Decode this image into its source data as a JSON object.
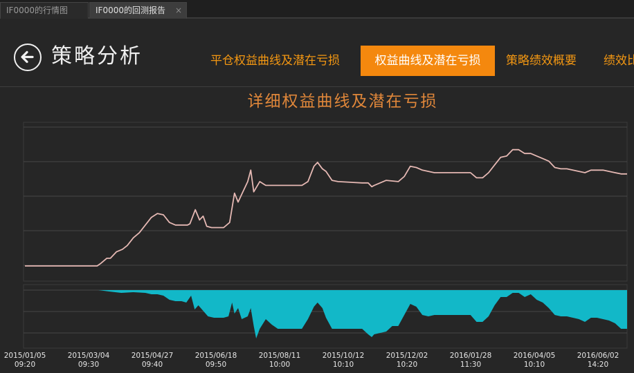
{
  "tabs": [
    {
      "label": "IF0000的行情图"
    },
    {
      "label": "IF0000的回测报告",
      "close": "×"
    }
  ],
  "header": {
    "title": "策略分析",
    "back_icon": "back-arrow-circle-icon"
  },
  "nav_tabs": [
    {
      "label": "平仓权益曲线及潜在亏损",
      "active": false
    },
    {
      "label": "权益曲线及潜在亏损",
      "active": true
    },
    {
      "label": "策略绩效概要",
      "active": false
    },
    {
      "label": "绩效比",
      "active": false
    }
  ],
  "colors": {
    "accent": "#f4880e",
    "equity_line": "#e6b9b4",
    "drawdown_fill": "#12b8c8",
    "background": "#262626"
  },
  "chart_data": {
    "type": "line",
    "title": "详细权益曲线及潜在亏损",
    "x_labels": [
      {
        "date": "2015/01/05",
        "time": "09:20"
      },
      {
        "date": "2015/03/04",
        "time": "09:30"
      },
      {
        "date": "2015/04/27",
        "time": "09:40"
      },
      {
        "date": "2015/06/18",
        "time": "09:50"
      },
      {
        "date": "2015/08/11",
        "time": "10:00"
      },
      {
        "date": "2015/10/12",
        "time": "10:10"
      },
      {
        "date": "2015/12/02",
        "time": "10:20"
      },
      {
        "date": "2016/01/28",
        "time": "11:30"
      },
      {
        "date": "2016/04/05",
        "time": "10:10"
      },
      {
        "date": "2016/06/02",
        "time": "14:20"
      }
    ],
    "x_range": [
      0,
      100
    ],
    "equity_range": [
      0,
      100
    ],
    "drawdown_range": [
      -40,
      0
    ],
    "grid": true,
    "series": [
      {
        "role": "equity",
        "points": [
          [
            0,
            0
          ],
          [
            12,
            0
          ],
          [
            12.6,
            2
          ],
          [
            13.6,
            6
          ],
          [
            14.2,
            6
          ],
          [
            15.2,
            11
          ],
          [
            16.2,
            13
          ],
          [
            17,
            16
          ],
          [
            18,
            22
          ],
          [
            19,
            26
          ],
          [
            20,
            32
          ],
          [
            21,
            38
          ],
          [
            22,
            41
          ],
          [
            23,
            40
          ],
          [
            24,
            34
          ],
          [
            25,
            32
          ],
          [
            26,
            32
          ],
          [
            27,
            32
          ],
          [
            27.4,
            33
          ],
          [
            28.3,
            44
          ],
          [
            29,
            36
          ],
          [
            29.6,
            39
          ],
          [
            30.2,
            31
          ],
          [
            31,
            30
          ],
          [
            32,
            30
          ],
          [
            33,
            30
          ],
          [
            34,
            34
          ],
          [
            34.8,
            57
          ],
          [
            35.4,
            50
          ],
          [
            36,
            56
          ],
          [
            37,
            66
          ],
          [
            37.5,
            75
          ],
          [
            38,
            58
          ],
          [
            39,
            66
          ],
          [
            40,
            63
          ],
          [
            42,
            63
          ],
          [
            44,
            63
          ],
          [
            46,
            63
          ],
          [
            47,
            66
          ],
          [
            48,
            78
          ],
          [
            48.6,
            81
          ],
          [
            49.4,
            76
          ],
          [
            50,
            74
          ],
          [
            51,
            67
          ],
          [
            52,
            66
          ],
          [
            56,
            65
          ],
          [
            57,
            65
          ],
          [
            57.6,
            62
          ],
          [
            58,
            63
          ],
          [
            60,
            67
          ],
          [
            62,
            66
          ],
          [
            63,
            70
          ],
          [
            64,
            78
          ],
          [
            65,
            77
          ],
          [
            66,
            75
          ],
          [
            67,
            74
          ],
          [
            68,
            73
          ],
          [
            74,
            73
          ],
          [
            75,
            69
          ],
          [
            76,
            69
          ],
          [
            77,
            73
          ],
          [
            78,
            79
          ],
          [
            79,
            85
          ],
          [
            80,
            86
          ],
          [
            81,
            91
          ],
          [
            82,
            91
          ],
          [
            83,
            88
          ],
          [
            84,
            88
          ],
          [
            85,
            86
          ],
          [
            86,
            84
          ],
          [
            87,
            82
          ],
          [
            88,
            77
          ],
          [
            89,
            76
          ],
          [
            90,
            76
          ],
          [
            91,
            75
          ],
          [
            92,
            74
          ],
          [
            93,
            73
          ],
          [
            94,
            75
          ],
          [
            95,
            75
          ],
          [
            96,
            75
          ],
          [
            97,
            74
          ],
          [
            98,
            73
          ],
          [
            99,
            72
          ],
          [
            100,
            72
          ]
        ]
      },
      {
        "role": "drawdown",
        "points": [
          [
            12.2,
            0
          ],
          [
            14,
            -1
          ],
          [
            16,
            -2
          ],
          [
            18,
            -1.5
          ],
          [
            20,
            -2
          ],
          [
            21,
            -3
          ],
          [
            22,
            -3
          ],
          [
            23,
            -4
          ],
          [
            24,
            -7
          ],
          [
            25,
            -8
          ],
          [
            26,
            -8
          ],
          [
            26.8,
            -9
          ],
          [
            27.6,
            -4
          ],
          [
            28.2,
            -14
          ],
          [
            28.8,
            -11
          ],
          [
            29.4,
            -14
          ],
          [
            30.4,
            -19
          ],
          [
            31.4,
            -20
          ],
          [
            33,
            -20
          ],
          [
            33.8,
            -19
          ],
          [
            34.4,
            -9
          ],
          [
            34.8,
            -17
          ],
          [
            35.4,
            -13
          ],
          [
            36,
            -21
          ],
          [
            37,
            -19
          ],
          [
            37.5,
            -13
          ],
          [
            38,
            -26
          ],
          [
            38.4,
            -35
          ],
          [
            39,
            -28
          ],
          [
            40,
            -21
          ],
          [
            41,
            -25
          ],
          [
            42,
            -28
          ],
          [
            44,
            -28
          ],
          [
            46,
            -28
          ],
          [
            47,
            -21
          ],
          [
            48,
            -12
          ],
          [
            48.6,
            -9
          ],
          [
            49.4,
            -13
          ],
          [
            50,
            -20
          ],
          [
            51,
            -28
          ],
          [
            52,
            -28
          ],
          [
            56,
            -28
          ],
          [
            57,
            -32
          ],
          [
            57.6,
            -34
          ],
          [
            58,
            -32
          ],
          [
            60,
            -30
          ],
          [
            61,
            -26
          ],
          [
            62,
            -26
          ],
          [
            63,
            -18
          ],
          [
            64,
            -10
          ],
          [
            65,
            -12
          ],
          [
            66,
            -18
          ],
          [
            67,
            -19
          ],
          [
            68,
            -18
          ],
          [
            72,
            -18
          ],
          [
            74,
            -18
          ],
          [
            75,
            -23
          ],
          [
            76,
            -23
          ],
          [
            77,
            -19
          ],
          [
            78,
            -11
          ],
          [
            79,
            -5
          ],
          [
            80,
            -5
          ],
          [
            81,
            -2
          ],
          [
            82,
            -2
          ],
          [
            83,
            -5
          ],
          [
            84,
            -3
          ],
          [
            85,
            -7
          ],
          [
            86,
            -9
          ],
          [
            87,
            -13
          ],
          [
            88,
            -18
          ],
          [
            89,
            -19
          ],
          [
            90,
            -19
          ],
          [
            91,
            -20
          ],
          [
            92,
            -21
          ],
          [
            93,
            -23
          ],
          [
            94,
            -20
          ],
          [
            95,
            -20
          ],
          [
            96,
            -21
          ],
          [
            97,
            -22
          ],
          [
            98,
            -24
          ],
          [
            99,
            -28
          ],
          [
            100,
            -28
          ]
        ]
      }
    ]
  }
}
